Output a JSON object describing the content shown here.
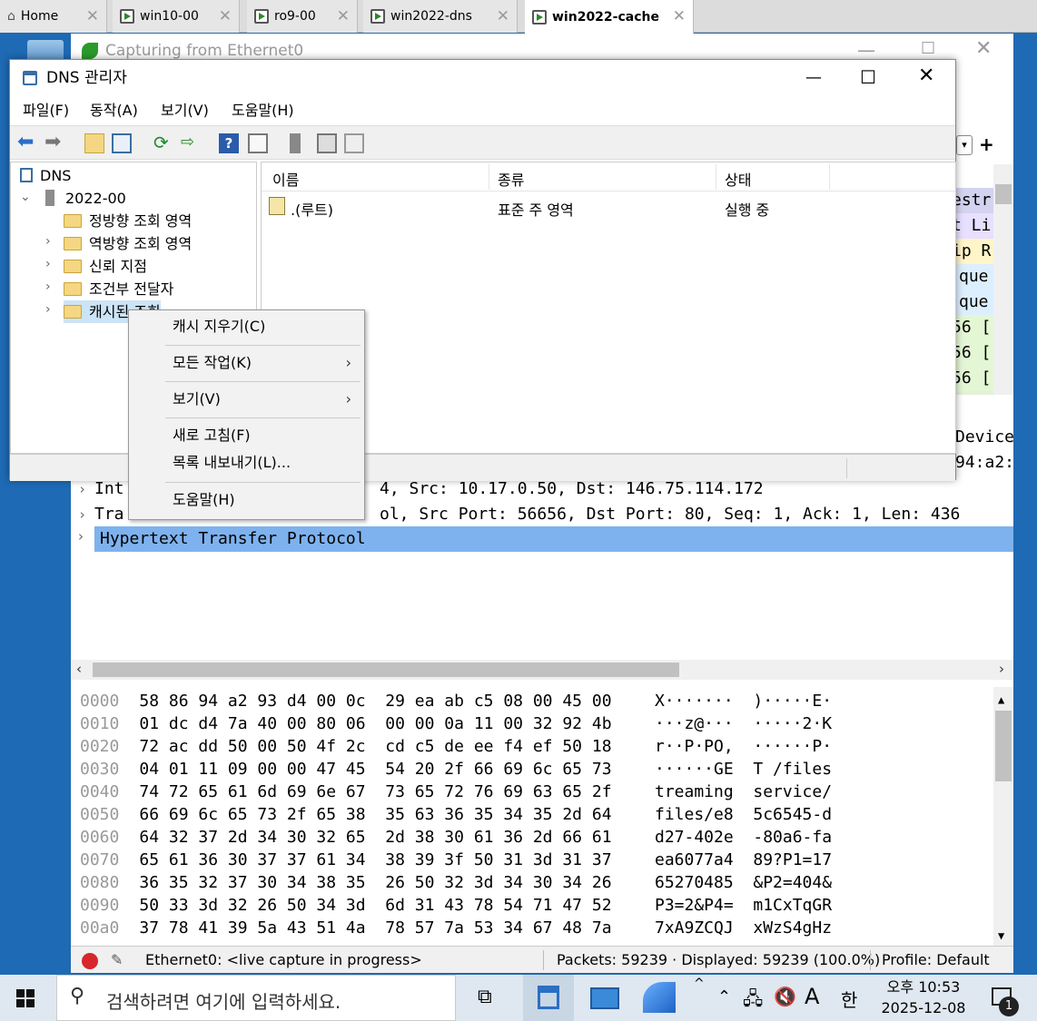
{
  "vm_tabs": [
    {
      "label": "Home"
    },
    {
      "label": "win10-00"
    },
    {
      "label": "ro9-00"
    },
    {
      "label": "win2022-dns"
    },
    {
      "label": "win2022-cache"
    }
  ],
  "wireshark": {
    "title": "Capturing from Ethernet0",
    "right_fragments": [
      "estr",
      "t Li",
      "ip R",
      "que",
      "que",
      "56 [",
      "56 [",
      "56 ["
    ],
    "device_fragments": [
      "Device",
      "94:a2:"
    ],
    "detail_rows": [
      "Int",
      "Tra",
      "Hypertext Transfer Protocol"
    ],
    "detail_row1_rest": "4, Src: 10.17.0.50, Dst: 146.75.114.172",
    "detail_row2_rest": "ol, Src Port: 56656, Dst Port: 80, Seq: 1, Ack: 1, Len: 436",
    "hex": [
      {
        "off": "0000",
        "hex": "58 86 94 a2 93 d4 00 0c  29 ea ab c5 08 00 45 00",
        "ascii": "X·······  )·····E·"
      },
      {
        "off": "0010",
        "hex": "01 dc d4 7a 40 00 80 06  00 00 0a 11 00 32 92 4b",
        "ascii": "···z@···  ·····2·K"
      },
      {
        "off": "0020",
        "hex": "72 ac dd 50 00 50 4f 2c  cd c5 de ee f4 ef 50 18",
        "ascii": "r··P·PO,  ······P·"
      },
      {
        "off": "0030",
        "hex": "04 01 11 09 00 00 47 45  54 20 2f 66 69 6c 65 73",
        "ascii": "······GE  T /files"
      },
      {
        "off": "0040",
        "hex": "74 72 65 61 6d 69 6e 67  73 65 72 76 69 63 65 2f",
        "ascii": "treaming  service/"
      },
      {
        "off": "0050",
        "hex": "66 69 6c 65 73 2f 65 38  35 63 36 35 34 35 2d 64",
        "ascii": "files/e8  5c6545-d"
      },
      {
        "off": "0060",
        "hex": "64 32 37 2d 34 30 32 65  2d 38 30 61 36 2d 66 61",
        "ascii": "d27-402e  -80a6-fa"
      },
      {
        "off": "0070",
        "hex": "65 61 36 30 37 37 61 34  38 39 3f 50 31 3d 31 37",
        "ascii": "ea6077a4  89?P1=17"
      },
      {
        "off": "0080",
        "hex": "36 35 32 37 30 34 38 35  26 50 32 3d 34 30 34 26",
        "ascii": "65270485  &P2=404&"
      },
      {
        "off": "0090",
        "hex": "50 33 3d 32 26 50 34 3d  6d 31 43 78 54 71 47 52",
        "ascii": "P3=2&P4=  m1CxTqGR"
      },
      {
        "off": "00a0",
        "hex": "37 78 41 39 5a 43 51 4a  78 57 7a 53 34 67 48 7a",
        "ascii": "7xA9ZCQJ  xWzS4gHz"
      }
    ],
    "status_iface": "Ethernet0: <live capture in progress>",
    "status_packets": "Packets: 59239 · Displayed: 59239 (100.0%)",
    "status_profile": "Profile: Default"
  },
  "dns": {
    "title": "DNS 관리자",
    "menu": [
      "파일(F)",
      "동작(A)",
      "보기(V)",
      "도움말(H)"
    ],
    "tree": {
      "root": "DNS",
      "server": "2022-00",
      "items": [
        "정방향 조회 영역",
        "역방향 조회 영역",
        "신뢰 지점",
        "조건부 전달자",
        "캐시된 조회"
      ]
    },
    "columns": [
      "이름",
      "종류",
      "상태"
    ],
    "rows": [
      {
        "name": ".(루트)",
        "type": "표준 주 영역",
        "status": "실행 중"
      }
    ]
  },
  "context_menu": {
    "items": [
      "캐시 지우기(C)",
      "모든 작업(K)",
      "보기(V)",
      "새로 고침(F)",
      "목록 내보내기(L)...",
      "도움말(H)"
    ]
  },
  "taskbar": {
    "search_placeholder": "검색하려면 여기에 입력하세요.",
    "ime": "A",
    "lang": "한",
    "time": "오후 10:53",
    "date": "2025-12-08",
    "notif_count": "1"
  }
}
